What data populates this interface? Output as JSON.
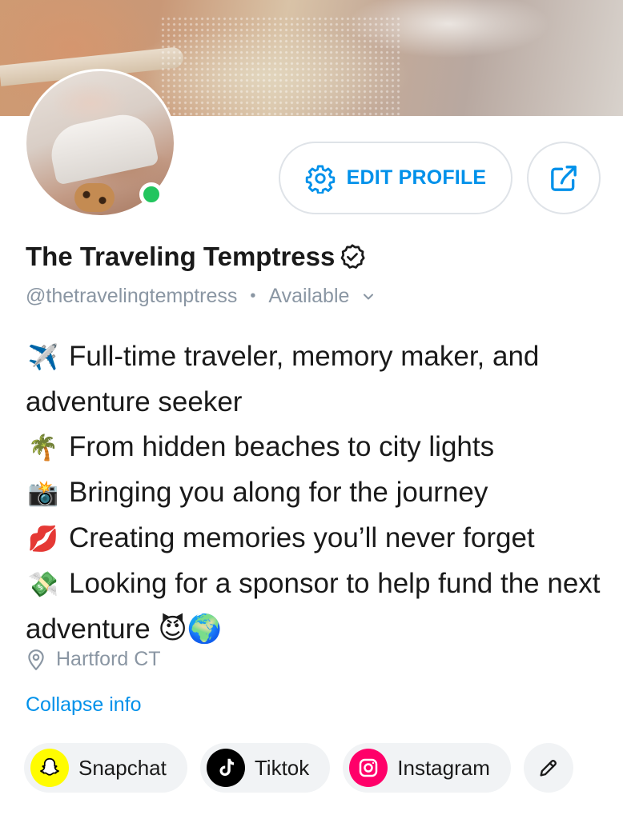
{
  "profile": {
    "display_name": "The Traveling Temptress",
    "handle": "@thetravelingtemptress",
    "separator": "•",
    "status": "Available",
    "location": "Hartford CT",
    "verified": true,
    "online": true
  },
  "actions": {
    "edit_profile_label": "EDIT PROFILE"
  },
  "bio": [
    {
      "emoji": "✈️",
      "text": "Full-time traveler, memory maker, and adventure seeker"
    },
    {
      "emoji": "🌴",
      "text": "From hidden beaches to city lights"
    },
    {
      "emoji": "📸",
      "text": "Bringing you along for the journey"
    },
    {
      "emoji": "💋",
      "text": "Creating memories you’ll never forget"
    },
    {
      "emoji": "💸",
      "text": "Looking for a sponsor to help fund the next adventure 😈🌍"
    }
  ],
  "links": {
    "collapse_label": "Collapse info"
  },
  "socials": [
    {
      "label": "Snapchat",
      "icon": "snapchat-icon"
    },
    {
      "label": "Tiktok",
      "icon": "tiktok-icon"
    },
    {
      "label": "Instagram",
      "icon": "instagram-icon"
    }
  ],
  "colors": {
    "accent": "#0091ea",
    "muted": "#8a96a3",
    "online": "#22c55e",
    "snapchat": "#fffc00",
    "tiktok": "#000000",
    "instagram": "#ff0069"
  }
}
